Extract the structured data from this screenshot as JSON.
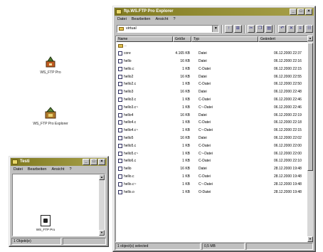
{
  "desktop": {
    "icons": [
      {
        "label": "WS_FTP Pro"
      },
      {
        "label": "WS_FTP Pro Explorer"
      }
    ]
  },
  "explorer": {
    "title": "ftp.WS.FTP Pro Explorer",
    "menu": [
      "Datei",
      "Bearbeiten",
      "Ansicht",
      "?"
    ],
    "path": "virtual",
    "columns": [
      "Name",
      "Größe",
      "Typ",
      "Geändert"
    ],
    "files": [
      {
        "name": "..",
        "size": "",
        "type": "",
        "modified": "",
        "icon": "folder"
      },
      {
        "name": "core",
        "size": "4.165 KB",
        "type": "Datei",
        "modified": "06.12.2000 22:37",
        "icon": "file"
      },
      {
        "name": "hello",
        "size": "16 KB",
        "type": "Datei",
        "modified": "06.12.2000 22:16",
        "icon": "file"
      },
      {
        "name": "hello.c",
        "size": "1 KB",
        "type": "C-Datei",
        "modified": "06.12.2000 22:15",
        "icon": "file"
      },
      {
        "name": "hello2",
        "size": "16 KB",
        "type": "Datei",
        "modified": "06.12.2000 22:55",
        "icon": "file"
      },
      {
        "name": "hello2.c",
        "size": "1 KB",
        "type": "C-Datei",
        "modified": "06.12.2000 22:50",
        "icon": "file"
      },
      {
        "name": "hello3",
        "size": "16 KB",
        "type": "Datei",
        "modified": "06.12.2000 22:48",
        "icon": "file"
      },
      {
        "name": "hello3.c",
        "size": "1 KB",
        "type": "C-Datei",
        "modified": "06.12.2000 22:46",
        "icon": "file"
      },
      {
        "name": "hello3.c~",
        "size": "1 KB",
        "type": "C~-Datei",
        "modified": "06.12.2000 22:46",
        "icon": "file"
      },
      {
        "name": "hello4",
        "size": "16 KB",
        "type": "Datei",
        "modified": "06.12.2000 22:19",
        "icon": "file"
      },
      {
        "name": "hello4.c",
        "size": "1 KB",
        "type": "C-Datei",
        "modified": "06.12.2000 22:18",
        "icon": "file"
      },
      {
        "name": "hello4.c~",
        "size": "1 KB",
        "type": "C~-Datei",
        "modified": "06.12.2000 22:15",
        "icon": "file"
      },
      {
        "name": "hello5",
        "size": "16 KB",
        "type": "Datei",
        "modified": "06.12.2000 22:02",
        "icon": "file"
      },
      {
        "name": "hello5.c",
        "size": "1 KB",
        "type": "C-Datei",
        "modified": "06.12.2000 22:00",
        "icon": "file"
      },
      {
        "name": "hello5.c~",
        "size": "1 KB",
        "type": "C~-Datei",
        "modified": "06.12.2000 22:00",
        "icon": "file"
      },
      {
        "name": "hello6.c",
        "size": "1 KB",
        "type": "C-Datei",
        "modified": "06.12.2000 22:10",
        "icon": "file"
      },
      {
        "name": "hello",
        "size": "16 KB",
        "type": "Datei",
        "modified": "28.12.2000 19:48",
        "icon": "file"
      },
      {
        "name": "hello.c",
        "size": "1 KB",
        "type": "C-Datei",
        "modified": "28.12.2000 19:48",
        "icon": "file"
      },
      {
        "name": "hello.c~",
        "size": "1 KB",
        "type": "C~-Datei",
        "modified": "28.12.2000 19:48",
        "icon": "file"
      },
      {
        "name": "hello.o",
        "size": "1 KB",
        "type": "O-Datei",
        "modified": "28.12.2000 19:48",
        "icon": "file"
      }
    ],
    "status": {
      "selected": "1 object(s) selected",
      "size": "0,5 MB"
    }
  },
  "small_window": {
    "title": "Testi",
    "menu": [
      "Datei",
      "Bearbeiten",
      "Ansicht",
      "?"
    ],
    "item_label": "WS_FTP Pro",
    "status": "1 Objekt(e)"
  },
  "colors": {
    "titlebar_start": "#807a20",
    "titlebar_end": "#a8a14a",
    "window_face": "#c0c0c0",
    "desktop": "#ffffff"
  }
}
